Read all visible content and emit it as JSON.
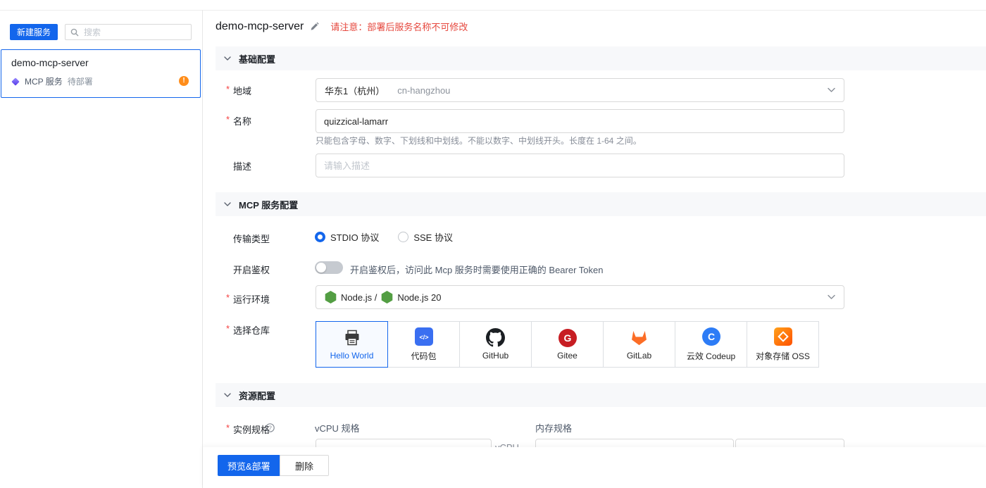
{
  "ui": {
    "required_marker": "*"
  },
  "icon_glyphs": {
    "exclamation": "!",
    "question_mark": "?",
    "gitee": "G",
    "codeup": "C",
    "code_package": "</>"
  },
  "colors": {
    "accent": "#1366ec",
    "warning_text": "#e6473d",
    "pending_badge_orange": "#ff8d1a",
    "node_green": "#539e43",
    "github_black": "#1b1f23",
    "gitee_red": "#c71d23",
    "gitlab_orange": "#fc6d26",
    "codeup_blue": "#2d7cf6",
    "oss_orange": "#ff5000"
  },
  "sidebar": {
    "new_service_button": "新建服务",
    "search_placeholder": "搜索",
    "service_card": {
      "title": "demo-mcp-server",
      "service_type": "MCP 服务",
      "status": "待部署"
    }
  },
  "header": {
    "title": "demo-mcp-server",
    "warning": "请注意：部署后服务名称不可修改"
  },
  "sections": {
    "basic": "基础配置",
    "mcp": "MCP 服务配置",
    "resource": "资源配置"
  },
  "form": {
    "region": {
      "label": "地域",
      "value": "华东1（杭州）",
      "code": "cn-hangzhou"
    },
    "name": {
      "label": "名称",
      "value": "quizzical-lamarr",
      "hint": "只能包含字母、数字、下划线和中划线。不能以数字、中划线开头。长度在 1-64 之间。"
    },
    "description": {
      "label": "描述",
      "placeholder": "请输入描述"
    },
    "transport": {
      "label": "传输类型",
      "options": [
        {
          "label": "STDIO 协议",
          "selected": true
        },
        {
          "label": "SSE 协议",
          "selected": false
        }
      ]
    },
    "auth": {
      "label": "开启鉴权",
      "enabled": false,
      "hint": "开启鉴权后，访问此 Mcp 服务时需要使用正确的 Bearer Token"
    },
    "runtime": {
      "label": "运行环境",
      "prefix": "Node.js /",
      "value": "Node.js 20"
    },
    "repository": {
      "label": "选择仓库",
      "selected": "Hello World",
      "options": [
        {
          "label": "Hello World",
          "icon": "printer-icon"
        },
        {
          "label": "代码包",
          "icon": "code-package-icon"
        },
        {
          "label": "GitHub",
          "icon": "github-icon"
        },
        {
          "label": "Gitee",
          "icon": "gitee-icon"
        },
        {
          "label": "GitLab",
          "icon": "gitlab-icon"
        },
        {
          "label": "云效 Codeup",
          "icon": "codeup-icon"
        },
        {
          "label": "对象存储 OSS",
          "icon": "oss-icon"
        }
      ]
    },
    "instance_spec": {
      "label": "实例规格",
      "vcpu_column_label": "vCPU 规格",
      "memory_column_label": "内存规格",
      "vcpu_unit": "vCPU"
    }
  },
  "footer": {
    "deploy_button": "预览&部署",
    "delete_button": "删除"
  }
}
